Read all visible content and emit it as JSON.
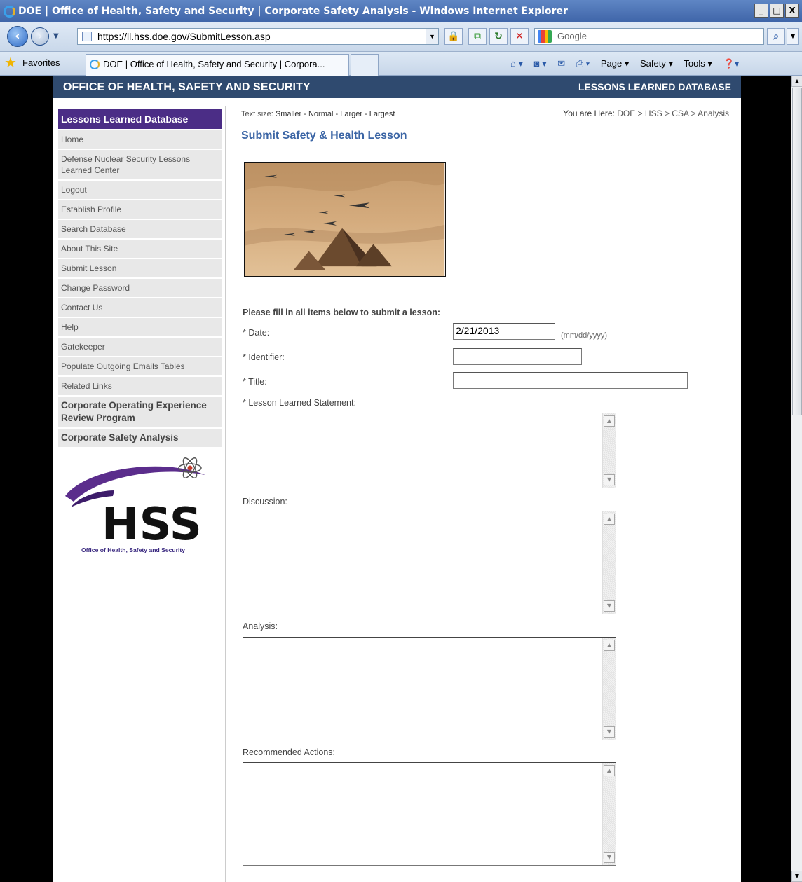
{
  "window": {
    "title": "DOE | Office of Health, Safety and Security | Corporate Safety Analysis - Windows Internet Explorer",
    "controls": [
      "_",
      "□",
      "X"
    ]
  },
  "address_bar": {
    "url": "https://ll.hss.doe.gov/SubmitLesson.asp",
    "search_placeholder": "Google"
  },
  "favorites_bar": {
    "favorites_label": "Favorites",
    "tab_title": "DOE | Office of Health, Safety and Security | Corpora...",
    "commands": [
      "Page ▾",
      "Safety ▾",
      "Tools ▾"
    ]
  },
  "site": {
    "header_title": "OFFICE OF HEALTH, SAFETY AND SECURITY",
    "header_db": "LESSONS LEARNED DATABASE",
    "sidebar": {
      "heading": "Lessons Learned Database",
      "items": [
        "Home",
        "Defense Nuclear Security Lessons Learned Center",
        "Logout",
        "Establish Profile",
        "Search Database",
        "About This Site",
        "Submit Lesson",
        "Change Password",
        "Contact Us",
        "Help",
        "Gatekeeper",
        "Populate Outgoing Emails Tables",
        "Related Links"
      ],
      "programs": [
        "Corporate Operating Experience Review Program",
        "Corporate Safety Analysis"
      ],
      "logo_text": "HSS",
      "logo_caption": "Office of Health, Safety and Security"
    },
    "main": {
      "text_size_label": "Text size:",
      "text_size_options": "Smaller - Normal - Larger - Largest",
      "breadcrumb_label": "You are Here:",
      "breadcrumb": "DOE > HSS > CSA > Analysis",
      "page_title": "Submit Safety & Health Lesson",
      "intro": "Please fill in all items below to submit a lesson:",
      "form": {
        "date_label": "* Date:",
        "date_value": "2/21/2013",
        "date_hint": "(mm/dd/yyyy)",
        "identifier_label": "* Identifier:",
        "identifier_value": "",
        "title_label": "* Title:",
        "title_value": "",
        "statement_label": "* Lesson Learned Statement:",
        "discussion_label": "Discussion:",
        "analysis_label": "Analysis:",
        "recommended_label": "Recommended Actions:"
      }
    }
  }
}
